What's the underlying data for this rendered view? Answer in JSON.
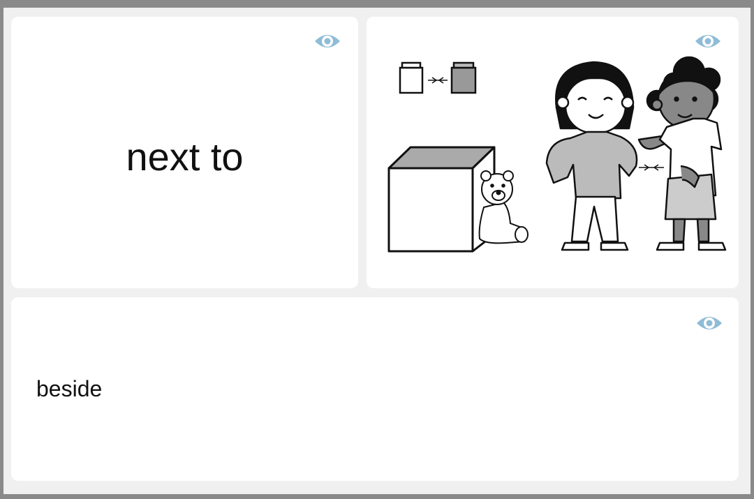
{
  "word_card": {
    "text": "next to",
    "eye_icon": "eye-icon"
  },
  "picture_card": {
    "eye_icon": "eye-icon",
    "illustration": "next-to-illustration"
  },
  "synonym_card": {
    "text": "beside",
    "eye_icon": "eye-icon"
  },
  "colors": {
    "eye": "#8fbcd6",
    "background": "#f0f0f0",
    "frame": "#8a8a8a"
  }
}
